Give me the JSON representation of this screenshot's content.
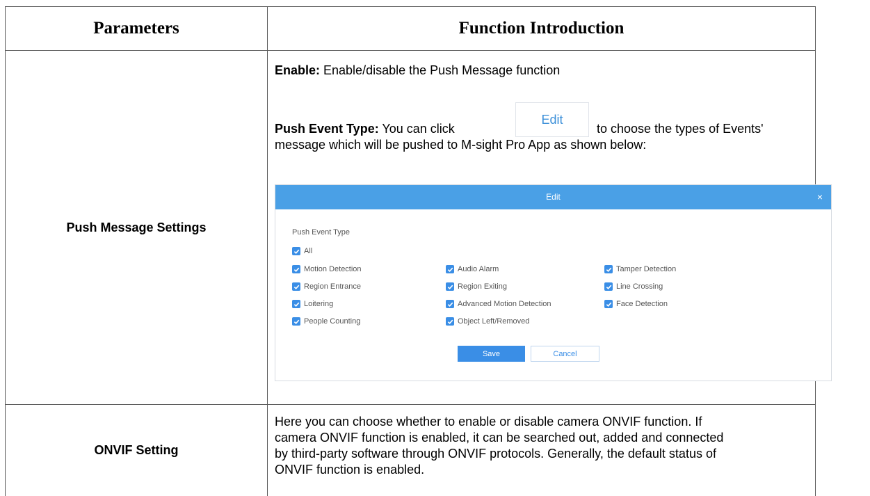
{
  "table": {
    "headers": [
      "Parameters",
      "Function Introduction"
    ],
    "rows": [
      {
        "parameter": "Push Message Settings",
        "enable_label": "Enable:",
        "enable_text": " Enable/disable the Push Message function",
        "push_label": "Push Event Type:",
        "push_text_before": " You can click",
        "edit_button_label": "Edit",
        "push_text_after": "to choose the types of Events'",
        "push_text_line2": "message which will be pushed to M-sight Pro App as shown below:"
      },
      {
        "parameter": "ONVIF Setting",
        "description_lines": [
          "Here you can choose whether to enable or disable camera ONVIF function. If",
          "camera ONVIF function is enabled, it can be searched out, added and connected",
          "by third-party software through ONVIF protocols. Generally, the default status of",
          "ONVIF function is enabled."
        ]
      }
    ]
  },
  "dialog": {
    "title": "Edit",
    "close_symbol": "×",
    "section_label": "Push Event Type",
    "all_label": "All",
    "all_checked": true,
    "options": [
      {
        "label": "Motion Detection",
        "checked": true
      },
      {
        "label": "Audio Alarm",
        "checked": true
      },
      {
        "label": "Tamper Detection",
        "checked": true
      },
      {
        "label": "Region Entrance",
        "checked": true
      },
      {
        "label": "Region Exiting",
        "checked": true
      },
      {
        "label": "Line Crossing",
        "checked": true
      },
      {
        "label": "Loitering",
        "checked": true
      },
      {
        "label": "Advanced Motion Detection",
        "checked": true
      },
      {
        "label": "Face Detection",
        "checked": true
      },
      {
        "label": "People Counting",
        "checked": true
      },
      {
        "label": "Object Left/Removed",
        "checked": true
      }
    ],
    "save_label": "Save",
    "cancel_label": "Cancel"
  },
  "colors": {
    "accent": "#3a8ee6",
    "dialog_header": "#4aa0e6",
    "border": "#5a5a5a"
  }
}
